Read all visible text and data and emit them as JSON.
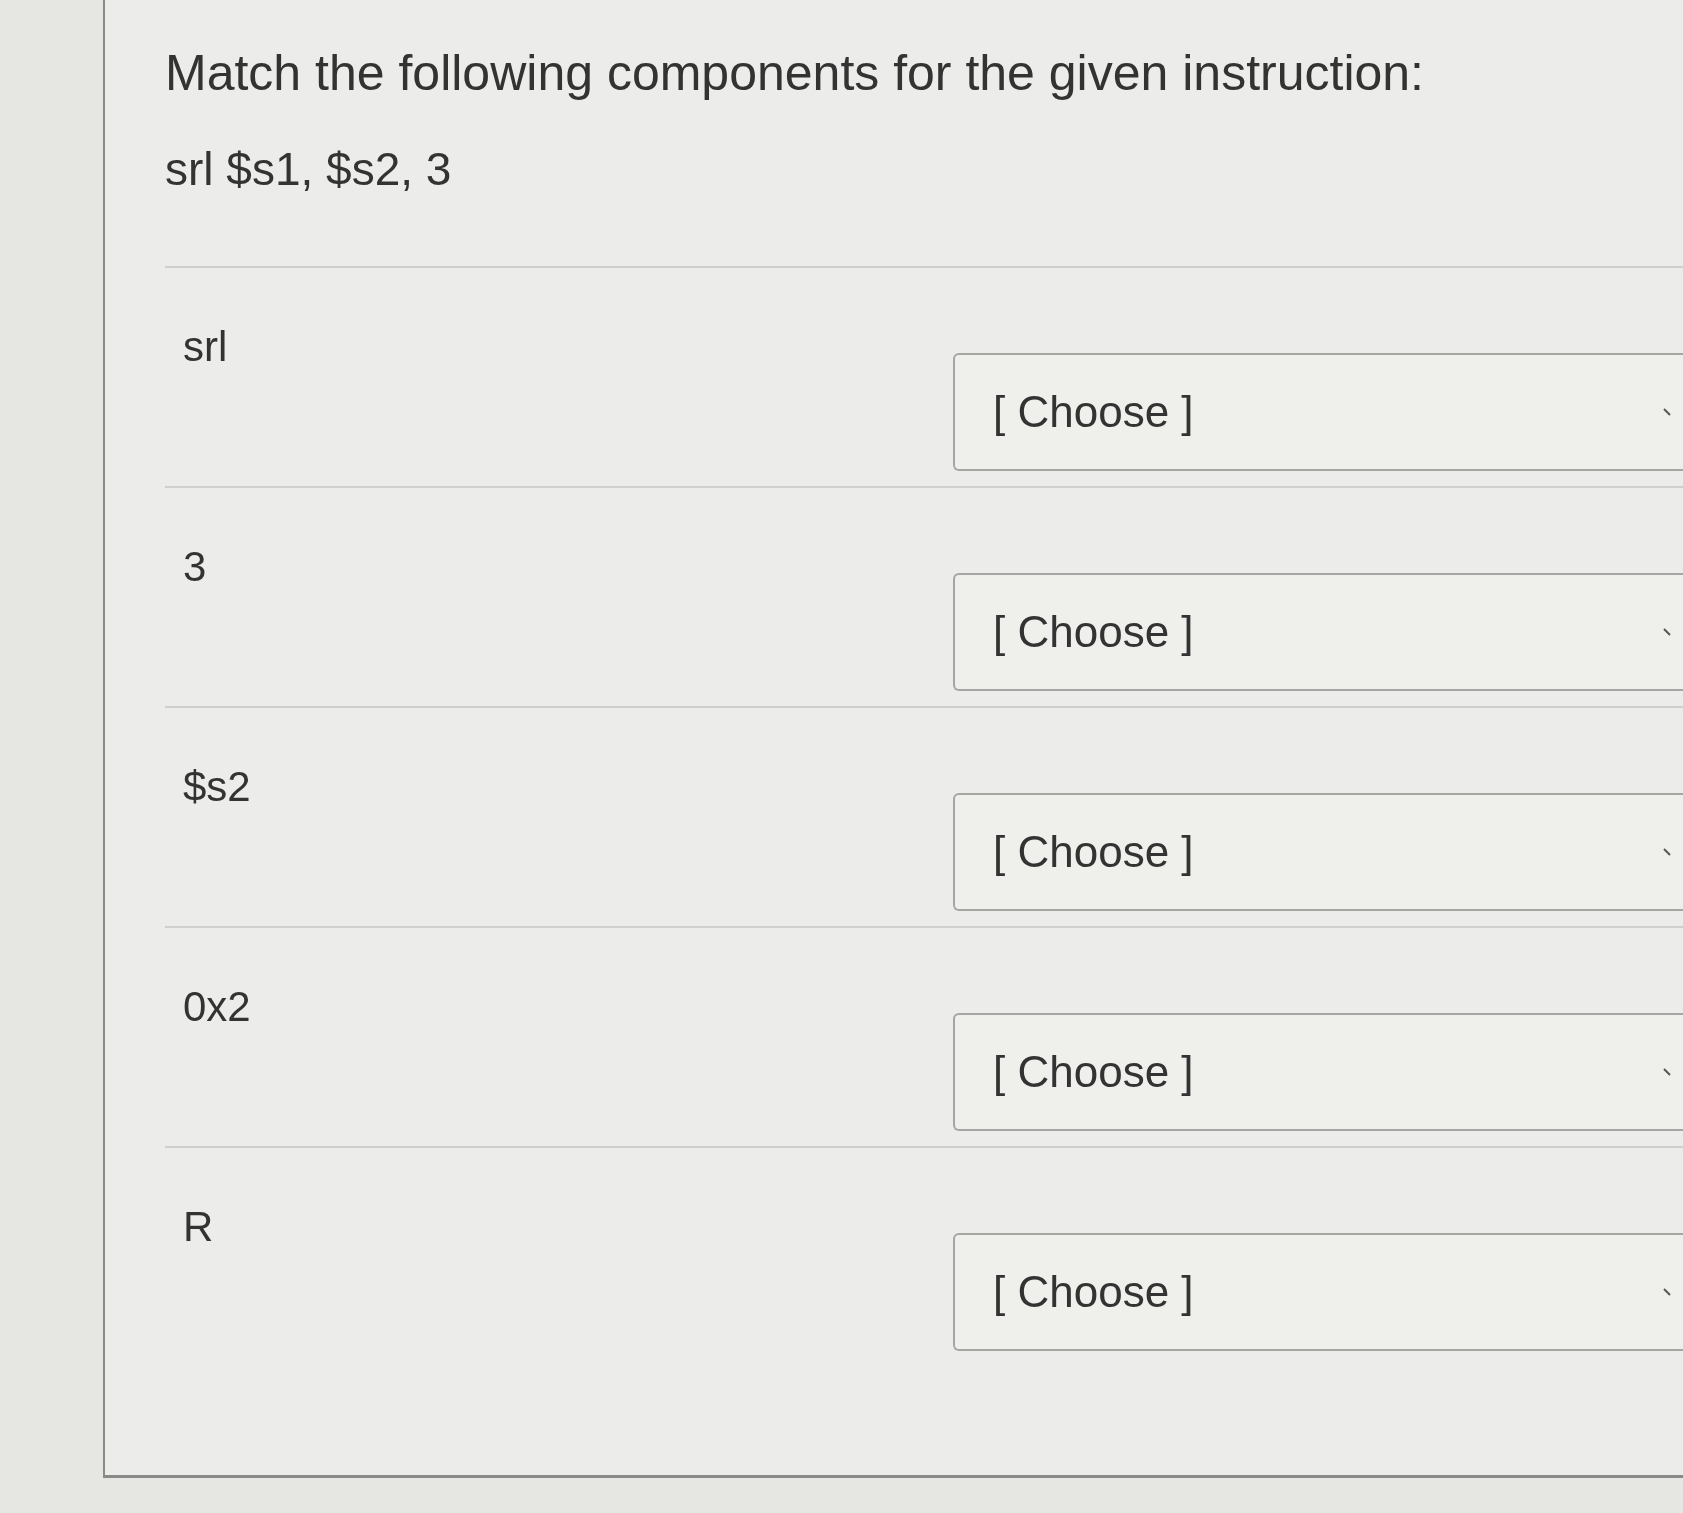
{
  "question": {
    "title": "Match the following components for the given instruction:",
    "instruction": "srl $s1, $s2, 3",
    "rows": [
      {
        "label": "srl",
        "choice": "[ Choose ]"
      },
      {
        "label": "3",
        "choice": "[ Choose ]"
      },
      {
        "label": "$s2",
        "choice": "[ Choose ]"
      },
      {
        "label": "0x2",
        "choice": "[ Choose ]"
      },
      {
        "label": "R",
        "choice": "[ Choose ]"
      }
    ]
  }
}
